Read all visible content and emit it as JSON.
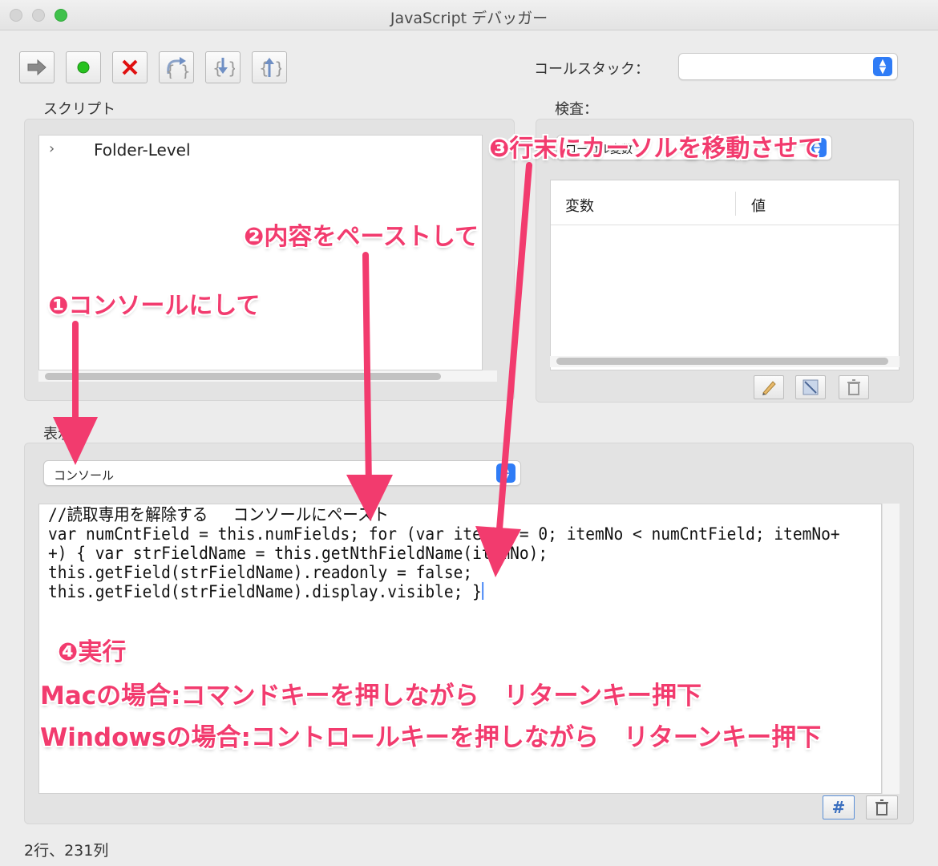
{
  "window": {
    "title": "JavaScript デバッガー"
  },
  "toolbar": {
    "icons": [
      "continue-icon",
      "step-over-green-icon",
      "stop-icon",
      "step-over-icon",
      "step-into-icon",
      "step-out-icon"
    ]
  },
  "callstack": {
    "label": "コールスタック：",
    "value": ""
  },
  "scripts": {
    "label": "スクリプト",
    "items": [
      {
        "label": "Folder-Level"
      }
    ]
  },
  "inspect": {
    "label": "検査：",
    "select_value": "ローカル変数",
    "columns": [
      "変数",
      "値"
    ]
  },
  "view": {
    "label": "表示",
    "select_value": "コンソール"
  },
  "console": {
    "lines": [
      "//読取専用を解除する　 コンソールにペースト",
      "var numCntField = this.numFields; for (var itemNo = 0; itemNo < numCntField; itemNo+",
      "+) { var strFieldName = this.getNthFieldName(itemNo);",
      "this.getField(strFieldName).readonly = false;",
      "this.getField(strFieldName).display.visible; }"
    ]
  },
  "status": {
    "text": "2行、231列"
  },
  "annotations": {
    "step1": "❶コンソールにして",
    "step2": "❷内容をペーストして",
    "step3": "❸行末にカーソルを移動させて",
    "step4": "❹実行",
    "mac": "Macの場合:コマンドキーを押しながら　リターンキー押下",
    "windows": "Windowsの場合:コントロールキーを押しながら　リターンキー押下"
  },
  "colors": {
    "annotation": "#f23b6e",
    "accent_blue": "#2f7cf6",
    "background": "#ececec"
  }
}
